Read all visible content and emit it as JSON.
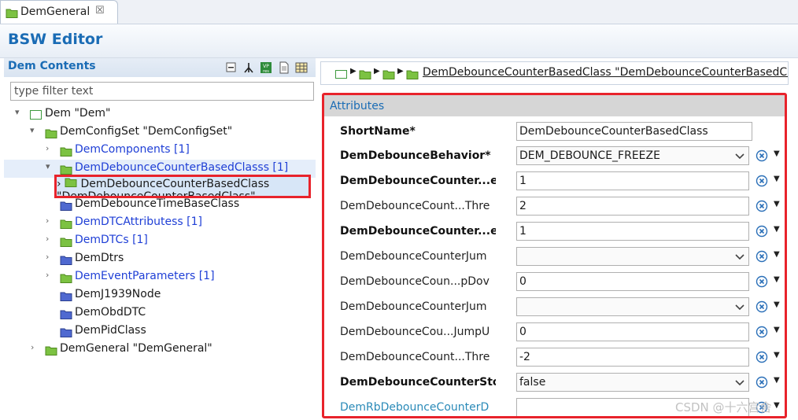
{
  "tab": {
    "label": "DemGeneral",
    "close": "☒"
  },
  "editor": {
    "title": "BSW Editor"
  },
  "left": {
    "title": "Dem Contents",
    "filter_placeholder": "type filter text",
    "tree": [
      {
        "label": "Dem \"Dem\""
      },
      {
        "label": "DemConfigSet \"DemConfigSet\""
      },
      {
        "label": "DemComponents [1]"
      },
      {
        "label": "DemDebounceCounterBasedClasss [1]"
      },
      {
        "label": "DemDebounceCounterBasedClass \"DemDebounceCounterBasedClass\""
      },
      {
        "label": "DemDebounceTimeBaseClass"
      },
      {
        "label": "DemDTCAttributess [1]"
      },
      {
        "label": "DemDTCs [1]"
      },
      {
        "label": "DemDtrs"
      },
      {
        "label": "DemEventParameters [1]"
      },
      {
        "label": "DemJ1939Node"
      },
      {
        "label": "DemObdDTC"
      },
      {
        "label": "DemPidClass"
      },
      {
        "label": "DemGeneral \"DemGeneral\""
      }
    ]
  },
  "breadcrumb": {
    "text": "DemDebounceCounterBasedClass \"DemDebounceCounterBasedClass\""
  },
  "attributes": {
    "title": "Attributes",
    "rows": [
      {
        "label": "ShortName*",
        "value": "DemDebounceCounterBasedClass"
      },
      {
        "label": "DemDebounceBehavior*",
        "value": "DEM_DEBOUNCE_FREEZE"
      },
      {
        "label": "DemDebounceCounter...e",
        "value": "1"
      },
      {
        "label": "DemDebounceCount...Thre",
        "value": "2"
      },
      {
        "label": "DemDebounceCounter...e",
        "value": "1"
      },
      {
        "label": "DemDebounceCounterJum",
        "value": ""
      },
      {
        "label": "DemDebounceCoun...pDov",
        "value": "0"
      },
      {
        "label": "DemDebounceCounterJum",
        "value": ""
      },
      {
        "label": "DemDebounceCou...JumpU",
        "value": "0"
      },
      {
        "label": "DemDebounceCount...Thre",
        "value": "-2"
      },
      {
        "label": "DemDebounceCounterSto",
        "value": "false"
      },
      {
        "label": "DemRbDebounceCounterD",
        "value": ""
      }
    ]
  },
  "watermark": "CSDN @十六宫舍",
  "colors": {
    "accent": "#1a6cb5",
    "highlight_border": "#e8232b",
    "link_blue": "#1f3fd6",
    "folder_green": "#7cc242",
    "folder_blue": "#4f69d0"
  }
}
